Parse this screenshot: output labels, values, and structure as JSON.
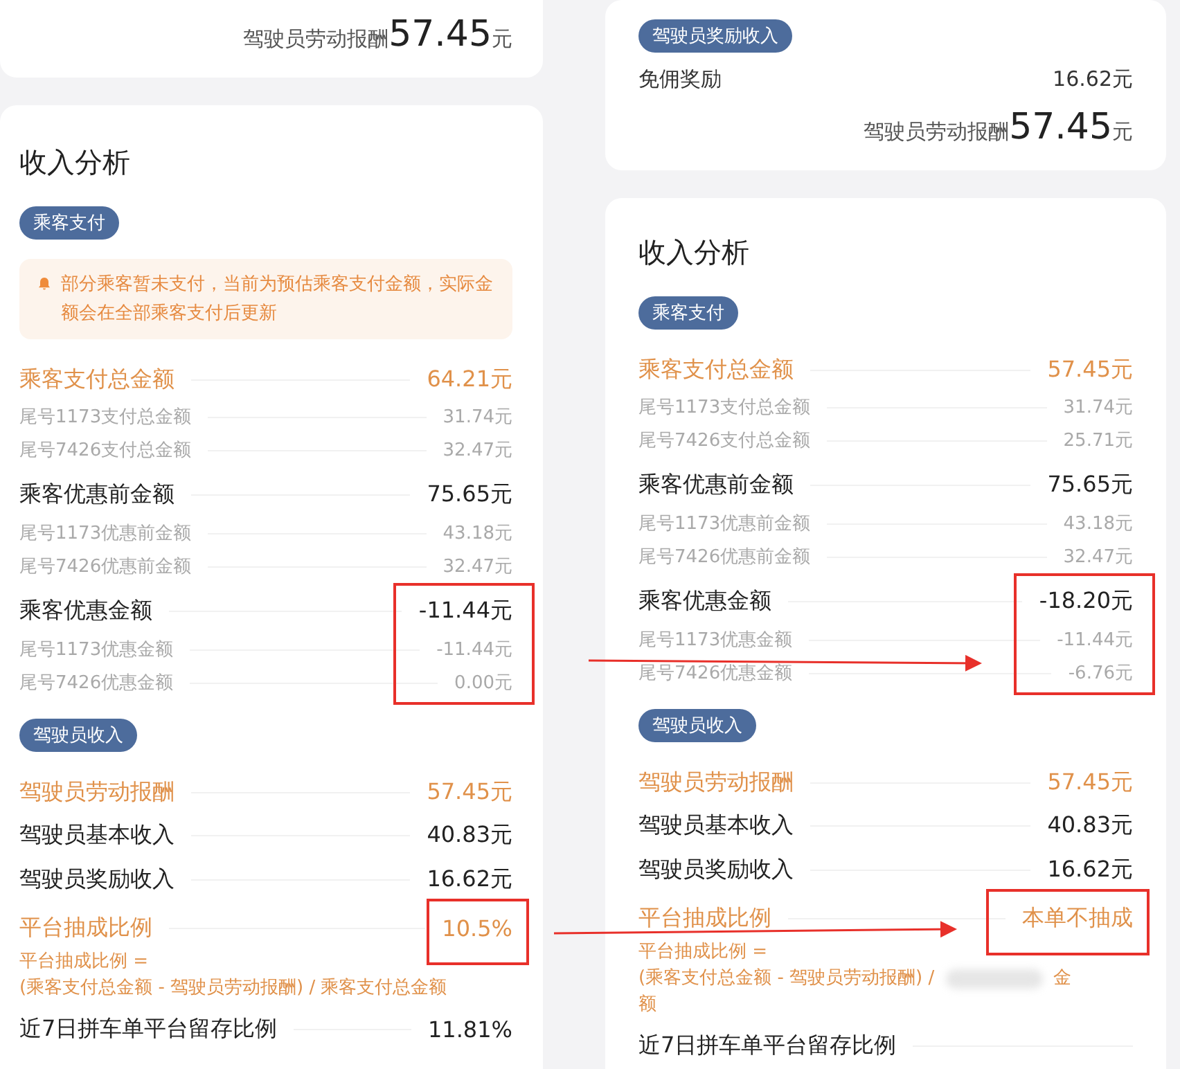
{
  "panels": [
    {
      "top_card": {
        "summary": {
          "label": "驾驶员劳动报酬",
          "amount": "57.45",
          "unit": "元"
        }
      },
      "analysis": {
        "title": "收入分析",
        "sections": [
          {
            "badge": "乘客支付",
            "notice": "部分乘客暂未支付，当前为预估乘客支付金额，实际金额会在全部乘客支付后更新",
            "groups": [
              {
                "boxed": false,
                "rows": [
                  {
                    "kind": "accent",
                    "label": "乘客支付总金额",
                    "value": "64.21元"
                  },
                  {
                    "kind": "sub",
                    "label": "尾号1173支付总金额",
                    "value": "31.74元"
                  },
                  {
                    "kind": "sub",
                    "label": "尾号7426支付总金额",
                    "value": "32.47元"
                  }
                ]
              },
              {
                "boxed": false,
                "rows": [
                  {
                    "kind": "main",
                    "label": "乘客优惠前金额",
                    "value": "75.65元"
                  },
                  {
                    "kind": "sub",
                    "label": "尾号1173优惠前金额",
                    "value": "43.18元"
                  },
                  {
                    "kind": "sub",
                    "label": "尾号7426优惠前金额",
                    "value": "32.47元"
                  }
                ]
              },
              {
                "boxed": true,
                "rows": [
                  {
                    "kind": "main",
                    "label": "乘客优惠金额",
                    "value": "-11.44元"
                  },
                  {
                    "kind": "sub",
                    "label": "尾号1173优惠金额",
                    "value": "-11.44元"
                  },
                  {
                    "kind": "sub",
                    "label": "尾号7426优惠金额",
                    "value": "0.00元"
                  }
                ]
              }
            ]
          },
          {
            "badge": "驾驶员收入",
            "groups": [
              {
                "boxed": false,
                "rows": [
                  {
                    "kind": "accent",
                    "label": "驾驶员劳动报酬",
                    "value": "57.45元"
                  },
                  {
                    "kind": "main",
                    "label": "驾驶员基本收入",
                    "value": "40.83元"
                  },
                  {
                    "kind": "main",
                    "label": "驾驶员奖励收入",
                    "value": "16.62元"
                  }
                ]
              },
              {
                "boxed": true,
                "rows": [
                  {
                    "kind": "accent",
                    "label": "平台抽成比例",
                    "value": "10.5%"
                  }
                ],
                "formula": {
                  "head": "平台抽成比例 =",
                  "parts": [
                    {
                      "kind": "text",
                      "text": "(乘客支付总金额 - 驾驶员劳动报酬) / 乘客支付总金额"
                    }
                  ]
                }
              },
              {
                "boxed": false,
                "rows": [
                  {
                    "kind": "main",
                    "label": "近7日拼车单平台留存比例",
                    "value": "11.81%"
                  }
                ]
              }
            ]
          }
        ]
      }
    },
    {
      "top_card": {
        "badge": "驾驶员奖励收入",
        "rows": [
          {
            "label": "免佣奖励",
            "value": "16.62元"
          }
        ],
        "summary": {
          "label": "驾驶员劳动报酬",
          "amount": "57.45",
          "unit": "元"
        }
      },
      "analysis": {
        "title": "收入分析",
        "sections": [
          {
            "badge": "乘客支付",
            "groups": [
              {
                "boxed": false,
                "rows": [
                  {
                    "kind": "accent",
                    "label": "乘客支付总金额",
                    "value": "57.45元"
                  },
                  {
                    "kind": "sub",
                    "label": "尾号1173支付总金额",
                    "value": "31.74元"
                  },
                  {
                    "kind": "sub",
                    "label": "尾号7426支付总金额",
                    "value": "25.71元"
                  }
                ]
              },
              {
                "boxed": false,
                "rows": [
                  {
                    "kind": "main",
                    "label": "乘客优惠前金额",
                    "value": "75.65元"
                  },
                  {
                    "kind": "sub",
                    "label": "尾号1173优惠前金额",
                    "value": "43.18元"
                  },
                  {
                    "kind": "sub",
                    "label": "尾号7426优惠前金额",
                    "value": "32.47元"
                  }
                ]
              },
              {
                "boxed": true,
                "rows": [
                  {
                    "kind": "main",
                    "label": "乘客优惠金额",
                    "value": "-18.20元"
                  },
                  {
                    "kind": "sub",
                    "label": "尾号1173优惠金额",
                    "value": "-11.44元"
                  },
                  {
                    "kind": "sub",
                    "label": "尾号7426优惠金额",
                    "value": "-6.76元"
                  }
                ]
              }
            ]
          },
          {
            "badge": "驾驶员收入",
            "groups": [
              {
                "boxed": false,
                "rows": [
                  {
                    "kind": "accent",
                    "label": "驾驶员劳动报酬",
                    "value": "57.45元"
                  },
                  {
                    "kind": "main",
                    "label": "驾驶员基本收入",
                    "value": "40.83元"
                  },
                  {
                    "kind": "main",
                    "label": "驾驶员奖励收入",
                    "value": "16.62元"
                  }
                ]
              },
              {
                "boxed": true,
                "rows": [
                  {
                    "kind": "accent",
                    "label": "平台抽成比例",
                    "value": "本单不抽成"
                  }
                ],
                "formula": {
                  "head": "平台抽成比例 =",
                  "parts": [
                    {
                      "kind": "text",
                      "text": "(乘客支付总金额 - 驾驶员劳动报酬) /"
                    },
                    {
                      "kind": "blur"
                    },
                    {
                      "kind": "text",
                      "text": "金"
                    },
                    {
                      "kind": "break"
                    },
                    {
                      "kind": "text",
                      "text": "额"
                    }
                  ]
                }
              },
              {
                "boxed": false,
                "rows": [
                  {
                    "kind": "main",
                    "label": "近7日拼车单平台留存比例"
                  }
                ]
              }
            ]
          }
        ]
      }
    }
  ],
  "annotations": [
    {
      "kind": "arrow"
    },
    {
      "kind": "arrow"
    }
  ]
}
